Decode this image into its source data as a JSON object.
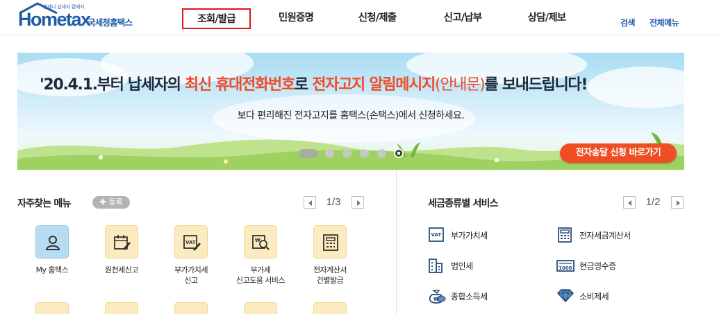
{
  "header": {
    "logo": {
      "tagline": "언제나 납세자 곁에서",
      "main": "Hometax",
      "sub": "국세청홈택스"
    },
    "nav": [
      {
        "label": "조회/발급",
        "active": true
      },
      {
        "label": "민원증명",
        "active": false
      },
      {
        "label": "신청/제출",
        "active": false
      },
      {
        "label": "신고/납부",
        "active": false
      },
      {
        "label": "상담/제보",
        "active": false
      }
    ],
    "util": {
      "search": "검색",
      "all_menu": "전체메뉴"
    }
  },
  "banner": {
    "title_1": "'20.4.1.부터 납세자의 ",
    "title_2": "최신 휴대전화번호",
    "title_3": "로 ",
    "title_4": "전자고지 알림메시지",
    "title_5": "(안내문)",
    "title_6": "를 보내드립니다!",
    "subtitle": "보다 편리해진 전자고지를 홈택스(손택스)에서 신청하세요.",
    "button": "전자송달 신청 바로가기",
    "slide_count": 6,
    "active_slide": 1
  },
  "favorites": {
    "title": "자주찾는 메뉴",
    "add_label": "등록",
    "page": "1/3",
    "items": [
      {
        "label": "My 홈택스",
        "icon": "person-icon"
      },
      {
        "label": "원천세신고",
        "icon": "calendar-pen-icon"
      },
      {
        "label": "부가가치세\n신고",
        "icon": "vat-doc-icon"
      },
      {
        "label": "부가세\n신고도움 서비스",
        "icon": "won-search-icon"
      },
      {
        "label": "전자계산서\n건별발급",
        "icon": "calculator-icon"
      }
    ]
  },
  "tax_services": {
    "title": "세금종류별 서비스",
    "page": "1/2",
    "items": [
      {
        "label": "부가가치세",
        "icon": "vat-icon"
      },
      {
        "label": "전자세금계산서",
        "icon": "calculator-icon"
      },
      {
        "label": "법인세",
        "icon": "building-icon"
      },
      {
        "label": "현금영수증",
        "icon": "receipt-icon"
      },
      {
        "label": "종합소득세",
        "icon": "money-bag-icon"
      },
      {
        "label": "소비제세",
        "icon": "diamond-icon"
      }
    ]
  },
  "colors": {
    "brand_blue": "#1f5ca8",
    "accent_orange": "#ef4e25",
    "active_nav_border": "#e0161b"
  }
}
